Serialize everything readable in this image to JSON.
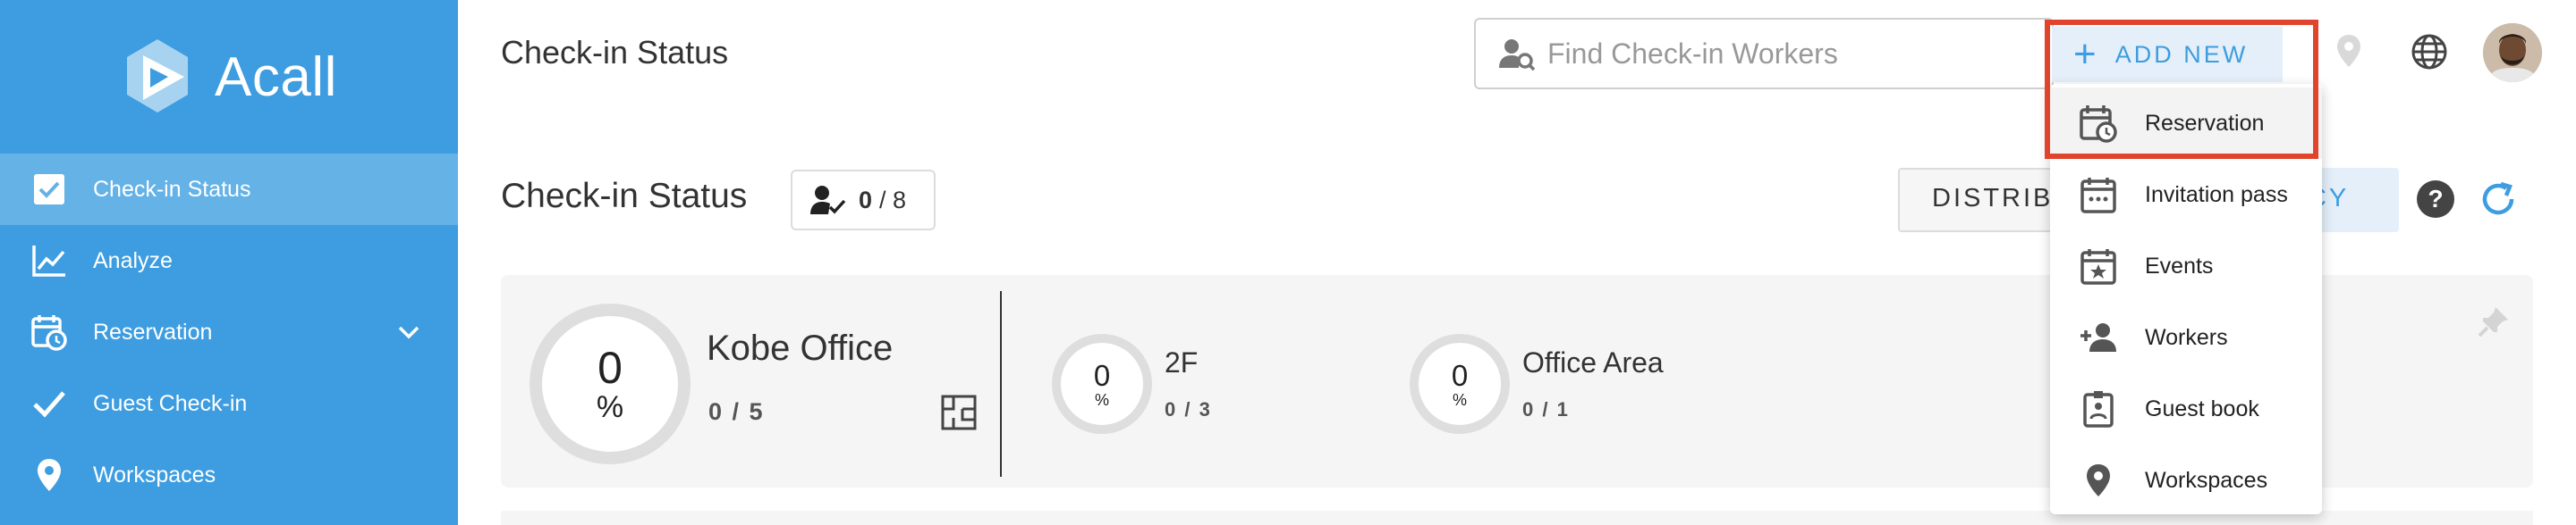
{
  "app": {
    "brand_name": "Acall",
    "accent_color": "#3d9de0",
    "highlight_color": "#e0442d"
  },
  "sidebar": {
    "items": [
      {
        "label": "Check-in Status",
        "icon": "checkbox-icon",
        "active": true
      },
      {
        "label": "Analyze",
        "icon": "line-chart-icon",
        "active": false
      },
      {
        "label": "Reservation",
        "icon": "calendar-clock-icon",
        "active": false,
        "expandable": true
      },
      {
        "label": "Guest Check-in",
        "icon": "checkmark-icon",
        "active": false
      },
      {
        "label": "Workspaces",
        "icon": "location-pin-icon",
        "active": false
      }
    ]
  },
  "header": {
    "title": "Check-in Status",
    "search_placeholder": "Find Check-in Workers",
    "add_new_label": "ADD NEW"
  },
  "main": {
    "section_title": "Check-in Status",
    "worker_count": "0",
    "worker_total": "/ 8",
    "distribution_label": "DISTRIBU",
    "efficiency_label": "NCY",
    "office": {
      "name": "Kobe Office",
      "percent": "0",
      "percent_sign": "%",
      "count": "0 / 5"
    },
    "areas": [
      {
        "name": "2F",
        "percent": "0",
        "percent_sign": "%",
        "count": "0 / 3"
      },
      {
        "name": "Office Area",
        "percent": "0",
        "percent_sign": "%",
        "count": "0 / 1"
      }
    ]
  },
  "dropdown": {
    "items": [
      {
        "label": "Reservation",
        "icon": "calendar-clock-icon"
      },
      {
        "label": "Invitation pass",
        "icon": "calendar-dots-icon"
      },
      {
        "label": "Events",
        "icon": "calendar-star-icon"
      },
      {
        "label": "Workers",
        "icon": "add-person-icon"
      },
      {
        "label": "Guest book",
        "icon": "id-badge-icon"
      },
      {
        "label": "Workspaces",
        "icon": "location-pin-icon"
      }
    ]
  }
}
